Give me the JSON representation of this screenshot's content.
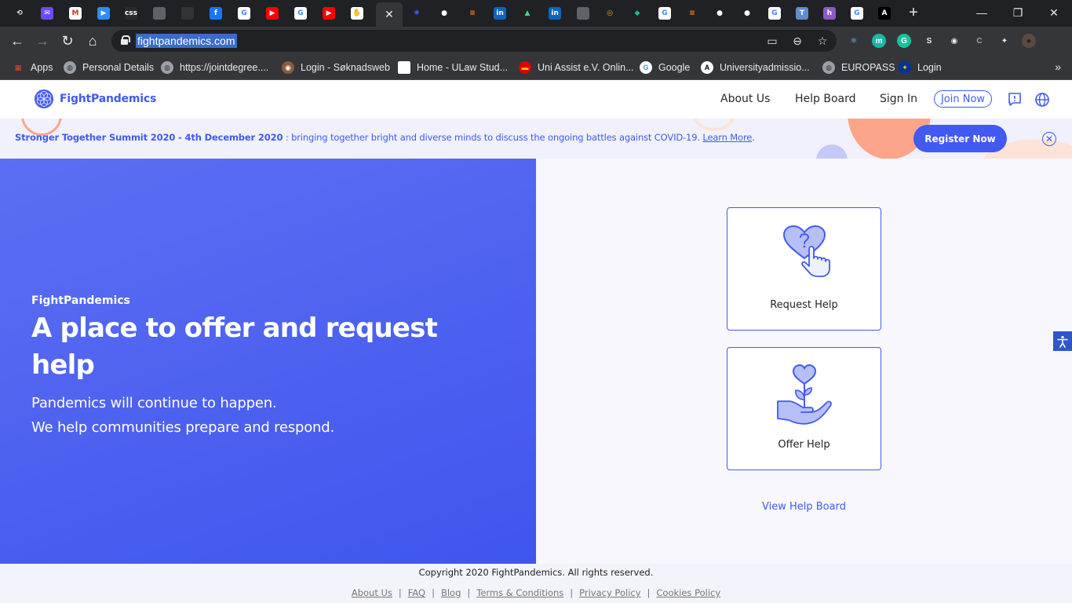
{
  "browser": {
    "tabs": [
      {
        "icon": "history-icon",
        "glyph": "⟲",
        "bg": "transparent",
        "fg": "#e8eaed"
      },
      {
        "icon": "proton-mail-icon",
        "glyph": "✉",
        "bg": "#6d4aff",
        "fg": "#ffffff"
      },
      {
        "icon": "gmail-icon",
        "glyph": "M",
        "bg": "#ffffff",
        "fg": "#d93025"
      },
      {
        "icon": "zoom-icon",
        "glyph": "▶",
        "bg": "#2d8cff",
        "fg": "#ffffff"
      },
      {
        "icon": "css-icon",
        "glyph": "css",
        "bg": "#2b2b2b",
        "fg": "#ffffff"
      },
      {
        "icon": "globe-icon",
        "glyph": "",
        "bg": "#5f6368",
        "fg": "#ffffff"
      },
      {
        "icon": "dark-site-icon",
        "glyph": "",
        "bg": "#333333",
        "fg": "#ffffff"
      },
      {
        "icon": "facebook-icon",
        "glyph": "f",
        "bg": "#1877f2",
        "fg": "#ffffff"
      },
      {
        "icon": "google-icon",
        "glyph": "G",
        "bg": "#ffffff",
        "fg": "#4285f4"
      },
      {
        "icon": "youtube-icon",
        "glyph": "▶",
        "bg": "#ff0000",
        "fg": "#ffffff"
      },
      {
        "icon": "google-icon",
        "glyph": "G",
        "bg": "#ffffff",
        "fg": "#4285f4"
      },
      {
        "icon": "youtube-icon",
        "glyph": "▶",
        "bg": "#ff0000",
        "fg": "#ffffff"
      },
      {
        "icon": "hand-icon",
        "glyph": "✋",
        "bg": "#ffffff",
        "fg": "#000000"
      },
      {
        "icon": "close-icon",
        "glyph": "✕",
        "bg": "transparent",
        "fg": "#e8eaed",
        "active": true
      },
      {
        "icon": "fightpandemics-icon",
        "glyph": "✺",
        "bg": "transparent",
        "fg": "#425af2"
      },
      {
        "icon": "github-icon",
        "glyph": "●",
        "bg": "transparent",
        "fg": "#ffffff"
      },
      {
        "icon": "stackoverflow-icon",
        "glyph": "≡",
        "bg": "transparent",
        "fg": "#f48024"
      },
      {
        "icon": "linkedin-icon",
        "glyph": "in",
        "bg": "#0a66c2",
        "fg": "#ffffff"
      },
      {
        "icon": "android-icon",
        "glyph": "▲",
        "bg": "transparent",
        "fg": "#3ddc84"
      },
      {
        "icon": "linkedin-icon",
        "glyph": "in",
        "bg": "#0a66c2",
        "fg": "#ffffff"
      },
      {
        "icon": "globe-icon",
        "glyph": "",
        "bg": "#5f6368",
        "fg": "#ffffff"
      },
      {
        "icon": "target-icon",
        "glyph": "◎",
        "bg": "transparent",
        "fg": "#f0a030"
      },
      {
        "icon": "diamond-icon",
        "glyph": "◆",
        "bg": "transparent",
        "fg": "#1abc9c"
      },
      {
        "icon": "google-icon",
        "glyph": "G",
        "bg": "#ffffff",
        "fg": "#4285f4"
      },
      {
        "icon": "stackoverflow-icon",
        "glyph": "≡",
        "bg": "transparent",
        "fg": "#f48024"
      },
      {
        "icon": "github-icon",
        "glyph": "●",
        "bg": "transparent",
        "fg": "#ffffff"
      },
      {
        "icon": "github-icon",
        "glyph": "●",
        "bg": "transparent",
        "fg": "#ffffff"
      },
      {
        "icon": "google-icon",
        "glyph": "G",
        "bg": "#ffffff",
        "fg": "#4285f4"
      },
      {
        "icon": "translate-icon",
        "glyph": "T",
        "bg": "#5f8dd3",
        "fg": "#ffffff"
      },
      {
        "icon": "hackerrank-icon",
        "glyph": "h",
        "bg": "#8e5ac8",
        "fg": "#ffffff"
      },
      {
        "icon": "google-icon",
        "glyph": "G",
        "bg": "#ffffff",
        "fg": "#4285f4"
      },
      {
        "icon": "a-icon",
        "glyph": "A",
        "bg": "#000000",
        "fg": "#ffffff"
      }
    ],
    "url": "fightpandemics.com",
    "extensions": [
      {
        "icon": "react-devtools-icon",
        "glyph": "⚛",
        "bg": "transparent",
        "fg": "#61dafb"
      },
      {
        "icon": "m-extension-icon",
        "glyph": "m",
        "bg": "#18b8a8",
        "fg": "#ffffff"
      },
      {
        "icon": "grammarly-icon",
        "glyph": "G",
        "bg": "#15c39a",
        "fg": "#ffffff"
      },
      {
        "icon": "s-extension-icon",
        "glyph": "S",
        "bg": "transparent",
        "fg": "#e8eaed"
      },
      {
        "icon": "circle-extension-icon",
        "glyph": "◉",
        "bg": "transparent",
        "fg": "#e8eaed"
      },
      {
        "icon": "c-extension-icon",
        "glyph": "C",
        "bg": "transparent",
        "fg": "#9aa0a6"
      },
      {
        "icon": "puzzle-icon",
        "glyph": "✦",
        "bg": "transparent",
        "fg": "#e8eaed"
      },
      {
        "icon": "profile-avatar-icon",
        "glyph": "●",
        "bg": "#5a4a40",
        "fg": "#222222"
      }
    ],
    "bookmarks": [
      {
        "label": "Apps",
        "icon": "apps-grid-icon",
        "bg": "transparent",
        "fg": "#ea4335",
        "glyph": "▦"
      },
      {
        "label": "Personal Details",
        "icon": "globe-icon",
        "bg": "#9aa0a6",
        "fg": "#35363a",
        "glyph": "◍"
      },
      {
        "label": "https://jointdegree....",
        "icon": "globe-icon",
        "bg": "#9aa0a6",
        "fg": "#35363a",
        "glyph": "◍"
      },
      {
        "label": "Login - Søknadsweb",
        "icon": "soknadsweb-icon",
        "bg": "#8a5a3a",
        "fg": "#ffffff",
        "glyph": "◉"
      },
      {
        "label": "Home - ULaw Stud...",
        "icon": "ulaw-icon",
        "bg": "#ffffff",
        "fg": "#000000",
        "glyph": ""
      },
      {
        "label": "Uni Assist e.V. Onlin...",
        "icon": "germany-flag-icon",
        "bg": "#dd0000",
        "fg": "#ffce00",
        "glyph": "▬"
      },
      {
        "label": "Google",
        "icon": "google-icon",
        "bg": "#ffffff",
        "fg": "#4285f4",
        "glyph": "G"
      },
      {
        "label": "Universityadmissio...",
        "icon": "ua-icon",
        "bg": "#ffffff",
        "fg": "#000000",
        "glyph": "A"
      },
      {
        "label": "EUROPASS",
        "icon": "globe-icon",
        "bg": "#9aa0a6",
        "fg": "#35363a",
        "glyph": "◍"
      },
      {
        "label": "Login",
        "icon": "eu-icon",
        "bg": "#003399",
        "fg": "#ffcc00",
        "glyph": "✦"
      }
    ]
  },
  "site": {
    "brand": "FightPandemics",
    "nav": {
      "about": "About Us",
      "help_board": "Help Board",
      "sign_in": "Sign In",
      "join": "Join Now"
    },
    "banner": {
      "title": "Stronger Together Summit 2020 - 4th December 2020",
      "text": " : bringing together bright and diverse minds to discuss the ongoing battles against COVID-19. ",
      "link": "Learn More",
      "after_link": ".",
      "cta": "Register Now"
    },
    "hero": {
      "kicker": "FightPandemics",
      "title": "A place to offer and request help",
      "line1": "Pandemics will continue to happen.",
      "line2": "We help communities prepare and respond."
    },
    "cards": {
      "request": "Request Help",
      "offer": "Offer Help"
    },
    "view_board": "View Help Board",
    "footer": {
      "copyright": "Copyright 2020 FightPandemics. All rights reserved.",
      "links": [
        "About Us",
        "FAQ",
        "Blog",
        "Terms & Conditions",
        "Privacy Policy",
        "Cookies Policy"
      ]
    },
    "colors": {
      "primary": "#425af2",
      "hero_gradient_start": "#5b6ff3",
      "hero_gradient_end": "#3f55ef",
      "banner_bg": "#f0f1fc",
      "accent_peach": "#fca58a"
    }
  }
}
